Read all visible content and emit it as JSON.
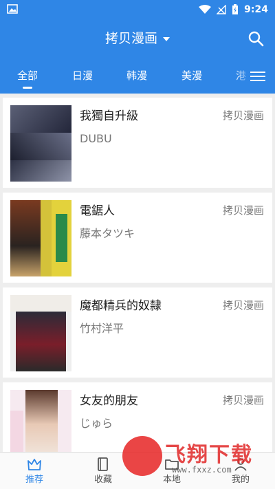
{
  "status_bar": {
    "time": "9:24"
  },
  "app_bar": {
    "title": "拷贝漫画"
  },
  "tabs": [
    {
      "label": "全部",
      "active": true
    },
    {
      "label": "日漫"
    },
    {
      "label": "韩漫"
    },
    {
      "label": "美漫"
    },
    {
      "label": "港"
    }
  ],
  "cards": [
    {
      "title": "我獨自升級",
      "author": "DUBU",
      "source": "拷贝漫画"
    },
    {
      "title": "電鋸人",
      "author": "藤本タツキ",
      "source": "拷贝漫画"
    },
    {
      "title": "魔都精兵的奴隸",
      "author": "竹村洋平",
      "source": "拷贝漫画"
    },
    {
      "title": "女友的朋友",
      "author": "じゅら",
      "source": "拷贝漫画"
    }
  ],
  "bottom_nav": [
    {
      "label": "推荐",
      "icon": "crown-icon",
      "active": true
    },
    {
      "label": "收藏",
      "icon": "book-icon"
    },
    {
      "label": "本地",
      "icon": "folder-icon"
    },
    {
      "label": "我的",
      "icon": "user-icon"
    }
  ],
  "watermark": {
    "text": "飞翔下载",
    "url": "www.fxxz.com"
  },
  "colors": {
    "primary": "#2f86e6",
    "background": "#eeeeee",
    "card": "#ffffff"
  }
}
